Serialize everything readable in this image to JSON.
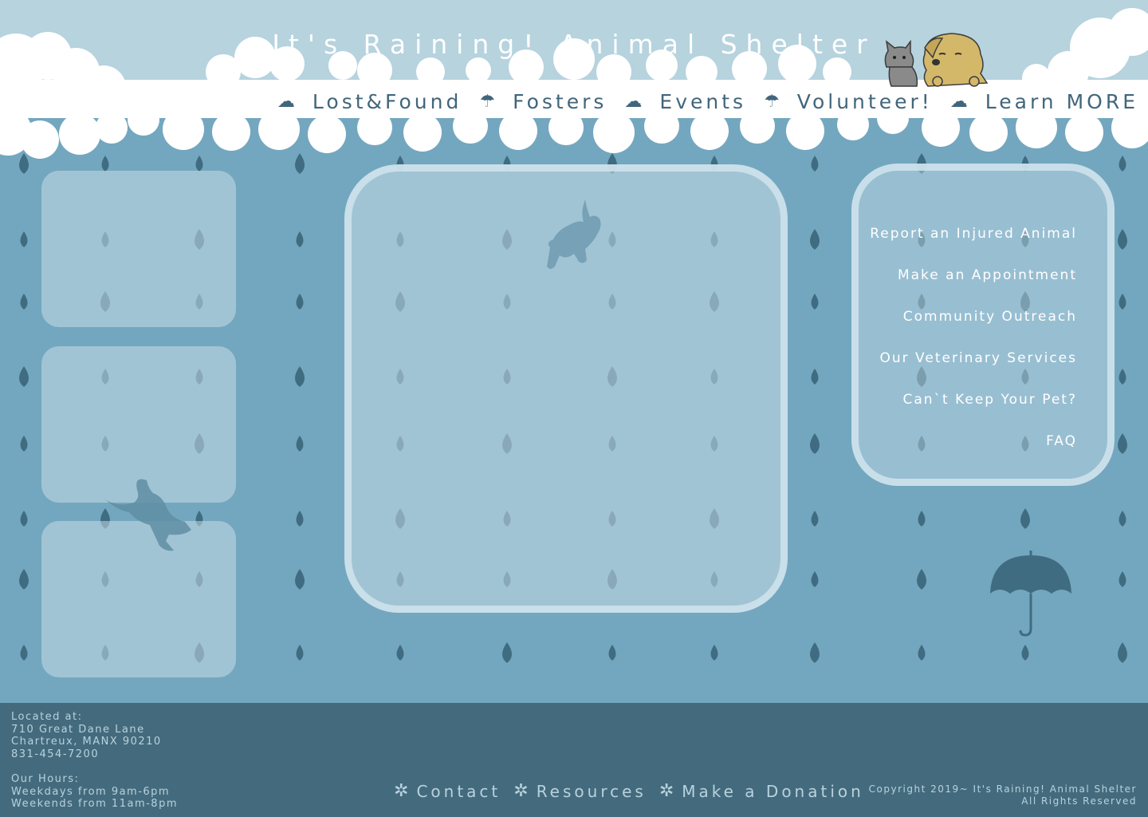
{
  "header": {
    "title": "It's Raining! Animal Shelter"
  },
  "nav": {
    "items": [
      {
        "label": "Lost&Found",
        "icon": "cloud-icon"
      },
      {
        "label": "Fosters",
        "icon": "umbrella-icon"
      },
      {
        "label": "Events",
        "icon": "cloud-icon"
      },
      {
        "label": "Volunteer!",
        "icon": "umbrella-icon"
      },
      {
        "label": "Learn MORE",
        "icon": "cloud-icon"
      }
    ]
  },
  "side_menu": {
    "links": [
      "Report an Injured Animal",
      "Make an Appointment",
      "Community Outreach",
      "Our Veterinary Services",
      "Can`t Keep Your Pet?",
      "FAQ"
    ]
  },
  "footer": {
    "location_label": "Located at:",
    "address_line1": "710 Great Dane Lane",
    "address_line2": "Chartreux, MANX 90210",
    "phone": "831-454-7200",
    "hours_label": "Our Hours:",
    "hours_weekdays": "Weekdays from 9am-6pm",
    "hours_weekends": "Weekends from 11am-8pm",
    "links": [
      "Contact",
      "Resources",
      "Make a Donation"
    ],
    "copyright_line1": "Copyright 2019~ It's Raining! Animal Shelter",
    "copyright_line2": "All Rights Reserved"
  },
  "colors": {
    "background": "#73a7bf",
    "sky": "#b6d3de",
    "raindrop": "#3f6c80",
    "nav_text": "#41667c",
    "footer": "#446b7d",
    "footer_text": "#b8d2dd",
    "dog": "#d4b86a",
    "cat": "#8a8a8a"
  }
}
